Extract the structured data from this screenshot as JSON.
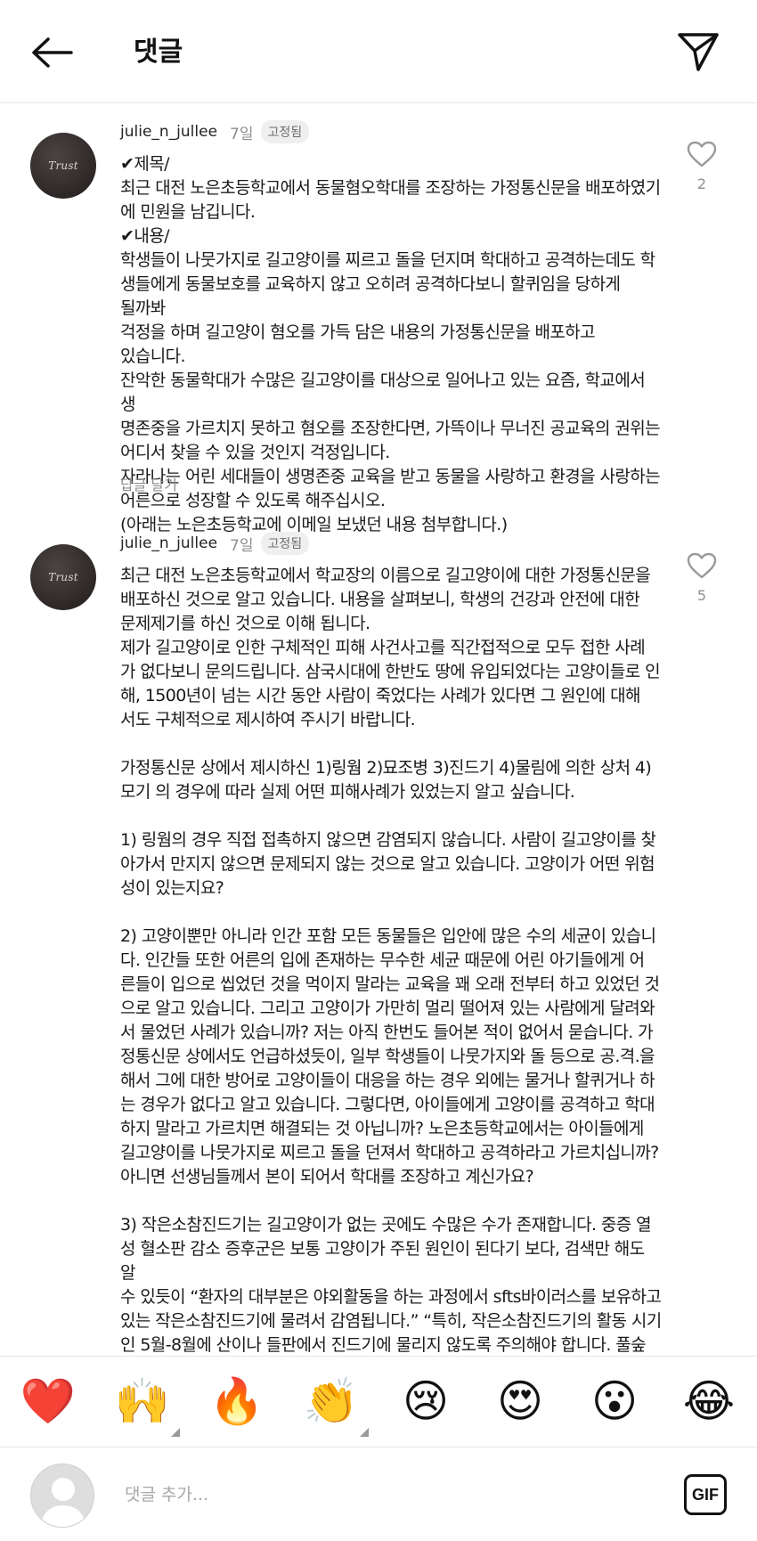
{
  "header": {
    "title": "댓글"
  },
  "comments": [
    {
      "username": "julie_n_jullee",
      "age": "7일",
      "pinned_label": "고정됨",
      "avatar_text": "Trust",
      "text": "✔제목/\n최근 대전 노은초등학교에서 동물혐오학대를 조장하는 가정통신문을 배포하였기\n에 민원을 남깁니다.\n✔내용/\n학생들이 나뭇가지로 길고양이를 찌르고 돌을 던지며 학대하고 공격하는데도 학\n생들에게 동물보호를 교육하지 않고 오히려 공격하다보니 할퀴임을 당하게 될까봐\n걱정을 하며 길고양이 혐오를 가득 담은 내용의 가정통신문을 배포하고 있습니다.\n잔악한 동물학대가 수많은 길고양이를 대상으로 일어나고 있는 요즘, 학교에서 생\n명존중을 가르치지 못하고 혐오를 조장한다면, 가뜩이나 무너진 공교육의 권위는\n어디서 찾을 수 있을 것인지 걱정입니다.\n자라나는 어린 세대들이 생명존중 교육을 받고 동물을 사랑하고 환경을 사랑하는\n어른으로 성장할 수 있도록 해주십시오.\n(아래는 노은초등학교에 이메일 보냈던 내용 첨부합니다.)",
      "reply_label": "답글 달기",
      "like_count": "2"
    },
    {
      "username": "julie_n_jullee",
      "age": "7일",
      "pinned_label": "고정됨",
      "avatar_text": "Trust",
      "text": "최근 대전 노은초등학교에서 학교장의 이름으로 길고양이에 대한 가정통신문을\n배포하신 것으로 알고 있습니다. 내용을 살펴보니, 학생의 건강과 안전에 대한\n문제제기를 하신 것으로 이해 됩니다.\n제가 길고양이로 인한 구체적인 피해 사건사고를 직간접적으로 모두 접한 사례\n가 없다보니 문의드립니다. 삼국시대에 한반도 땅에 유입되었다는 고양이들로 인\n해, 1500년이 넘는 시간 동안 사람이 죽었다는 사례가 있다면 그 원인에 대해\n서도 구체적으로 제시하여 주시기 바랍니다.\n\n가정통신문 상에서 제시하신 1)링웜 2)묘조병 3)진드기 4)물림에 의한 상처 4)\n모기 의 경우에 따라 실제 어떤 피해사례가 있었는지 알고 싶습니다.\n\n1) 링웜의 경우 직접 접촉하지 않으면 감염되지 않습니다. 사람이 길고양이를 찾\n아가서 만지지 않으면 문제되지 않는 것으로 알고 있습니다. 고양이가 어떤 위험\n성이 있는지요?\n\n2) 고양이뿐만 아니라 인간 포함 모든 동물들은 입안에 많은 수의 세균이 있습니\n다. 인간들 또한 어른의 입에 존재하는 무수한 세균 때문에 어린 아기들에게 어\n른들이 입으로 씹었던 것을 먹이지 말라는 교육을 꽤 오래 전부터 하고 있었던 것\n으로 알고 있습니다. 그리고 고양이가 가만히 멀리 떨어져 있는 사람에게 달려와\n서 물었던 사례가 있습니까? 저는 아직 한번도 들어본 적이 없어서 묻습니다. 가\n정통신문 상에서도 언급하셨듯이, 일부 학생들이 나뭇가지와 돌 등으로 공.격.을\n해서 그에 대한 방어로 고양이들이 대응을 하는 경우 외에는 물거나 할퀴거나 하\n는 경우가 없다고 알고 있습니다. 그렇다면, 아이들에게 고양이를 공격하고 학대\n하지 말라고 가르치면 해결되는 것 아닙니까? 노은초등학교에서는 아이들에게\n길고양이를 나뭇가지로 찌르고 돌을 던져서 학대하고 공격하라고 가르치십니까?\n아니면 선생님들께서 본이 되어서 학대를 조장하고 계신가요?\n\n3) 작은소참진드기는 길고양이가 없는 곳에도 수많은 수가 존재합니다. 중증 열\n성 혈소판 감소 증후군은 보통 고양이가 주된 원인이 된다기 보다, 검색만 해도 알\n수 있듯이 “환자의 대부분은 야외활동을 하는 과정에서 sfts바이러스를 보유하고\n있는 작은소참진드기에 물려서 감염됩니다.” “특히, 작은소참진드기의 활동 시기\n인 5월-8월에 산이나 들판에서 진드기에 물리지 않도록 주의해야 합니다. 풀숲\n에 들어갈 때에는 긴 소매, 긴 바지 등을 착용하여 피부노출을 최소화해야 합니",
      "like_count": "5"
    }
  ],
  "emoji_bar": [
    {
      "glyph": "❤️",
      "name": "red-heart"
    },
    {
      "glyph": "🙌",
      "name": "raising-hands",
      "has_variants": true
    },
    {
      "glyph": "🔥",
      "name": "fire"
    },
    {
      "glyph": "👏",
      "name": "clapping-hands",
      "has_variants": true
    },
    {
      "glyph": "😢",
      "name": "crying-face"
    },
    {
      "glyph": "😍",
      "name": "heart-eyes-face"
    },
    {
      "glyph": "😮",
      "name": "surprised-face"
    },
    {
      "glyph": "😂",
      "name": "tears-of-joy-face"
    }
  ],
  "composer": {
    "placeholder": "댓글 추가...",
    "value": "",
    "gif_label": "GIF"
  }
}
